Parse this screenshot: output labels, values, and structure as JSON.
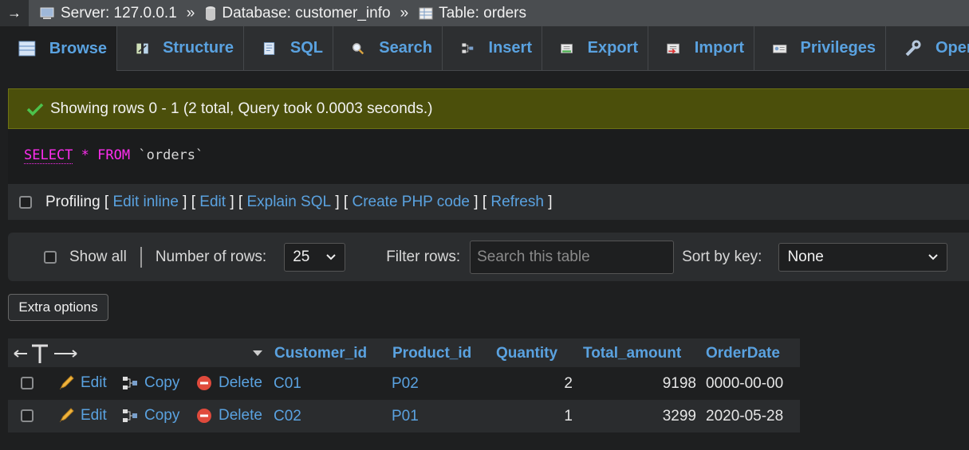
{
  "breadcrumb": {
    "server": "Server: 127.0.0.1",
    "database": "Database: customer_info",
    "table": "Table: orders",
    "separator": "»"
  },
  "tabs": [
    {
      "label": "Browse",
      "icon": "browse-icon"
    },
    {
      "label": "Structure",
      "icon": "structure-icon"
    },
    {
      "label": "SQL",
      "icon": "sql-icon"
    },
    {
      "label": "Search",
      "icon": "search-icon"
    },
    {
      "label": "Insert",
      "icon": "insert-icon"
    },
    {
      "label": "Export",
      "icon": "export-icon"
    },
    {
      "label": "Import",
      "icon": "import-icon"
    },
    {
      "label": "Privileges",
      "icon": "privileges-icon"
    },
    {
      "label": "Opera",
      "icon": "operations-icon"
    }
  ],
  "message": "Showing rows 0 - 1 (2 total, Query took 0.0003 seconds.)",
  "sql": {
    "select": "SELECT",
    "star": "*",
    "from": "FROM",
    "table": "`orders`"
  },
  "profiling": {
    "label": "Profiling",
    "links": [
      "Edit inline",
      "Edit",
      "Explain SQL",
      "Create PHP code",
      "Refresh"
    ]
  },
  "filter": {
    "show_all": "Show all",
    "rows_label": "Number of rows:",
    "rows_value": "25",
    "filter_label": "Filter rows:",
    "filter_placeholder": "Search this table",
    "sort_label": "Sort by key:",
    "sort_value": "None"
  },
  "extra_options": "Extra options",
  "table": {
    "columns": [
      "Customer_id",
      "Product_id",
      "Quantity",
      "Total_amount",
      "OrderDate"
    ],
    "actions": {
      "edit": "Edit",
      "copy": "Copy",
      "delete": "Delete"
    },
    "rows": [
      {
        "customer_id": "C01",
        "product_id": "P02",
        "quantity": "2",
        "total_amount": "9198",
        "order_date": "0000-00-00"
      },
      {
        "customer_id": "C02",
        "product_id": "P01",
        "quantity": "1",
        "total_amount": "3299",
        "order_date": "2020-05-28"
      }
    ]
  }
}
